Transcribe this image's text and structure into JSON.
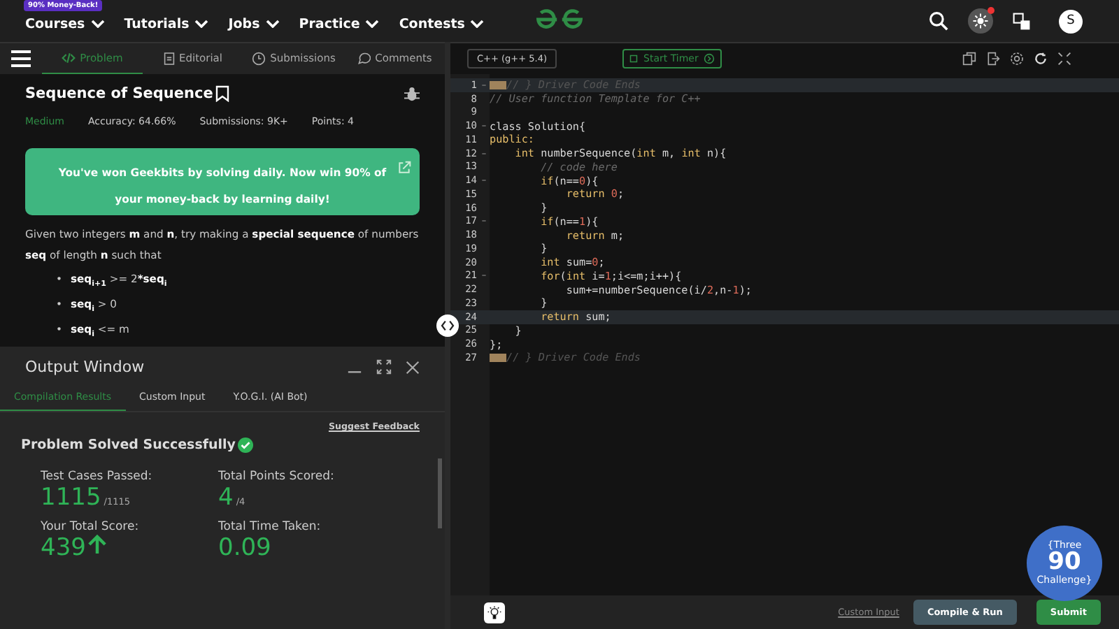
{
  "navbar": {
    "badge": "90% Money-Back!",
    "menus": [
      "Courses",
      "Tutorials",
      "Jobs",
      "Practice",
      "Contests"
    ],
    "avatar": "S",
    "notification": true
  },
  "problem_tabs": [
    {
      "label": "Problem",
      "selected": true
    },
    {
      "label": "Editorial",
      "selected": false
    },
    {
      "label": "Submissions",
      "selected": false
    },
    {
      "label": "Comments",
      "selected": false
    }
  ],
  "problem": {
    "title": "Sequence of Sequence",
    "difficulty": "Medium",
    "accuracy": "Accuracy: 64.66%",
    "submissions": "Submissions: 9K+",
    "points": "Points: 4",
    "banner": "You've won Geekbits by solving daily. Now win 90% of your money-back by learning daily!",
    "statement": "Given two integers **m** and **n**, try making a **special sequence** of numbers **seq** of length **n** such that",
    "conditions": [
      {
        "bullet": "•",
        "text": "**seq$_{i+1}$** >= 2***seq$_{i}$**"
      },
      {
        "bullet": "•",
        "text": "**seq$_{i}$** > 0"
      },
      {
        "bullet": "•",
        "text": "**seq$_{i}$** <= m"
      }
    ]
  },
  "output_window": {
    "title": "Output Window",
    "tabs": [
      {
        "label": "Compilation Results",
        "selected": true
      },
      {
        "label": "Custom Input",
        "selected": false
      },
      {
        "label": "Y.O.G.I. (AI Bot)",
        "selected": false
      }
    ],
    "feedback_link": "Suggest Feedback",
    "status": "Problem Solved Successfully",
    "stats": [
      {
        "label": "Test Cases Passed:",
        "value": "1115",
        "total": "/1115",
        "trend": false
      },
      {
        "label": "Total Points Scored:",
        "value": "4",
        "total": "/4",
        "trend": false
      },
      {
        "label": "Your Total Score:",
        "value": "439",
        "trend": true
      },
      {
        "label": "Total Time Taken:",
        "value": "0.09",
        "trend": false
      }
    ]
  },
  "editor": {
    "language": "C++ (g++ 5.4)",
    "timer_button": "Start Timer",
    "lines": [
      {
        "number": "1",
        "fold": true,
        "marker": true,
        "active": true,
        "code": [
          {
            "text": "// } Driver Code Ends",
            "kind": "dim"
          }
        ]
      },
      {
        "number": "8",
        "fold": false,
        "marker": false,
        "active": false,
        "code": [
          {
            "text": "// User function Template for C++",
            "kind": "comment"
          }
        ]
      },
      {
        "number": "9",
        "fold": false,
        "marker": false,
        "active": false
      },
      {
        "number": "10",
        "fold": true,
        "marker": false,
        "active": false,
        "code": [
          {
            "text": "class Solution{",
            "kind": "plain"
          }
        ]
      },
      {
        "number": "11",
        "fold": false,
        "marker": false,
        "active": false,
        "code": [
          {
            "text": "public:",
            "kind": "kw"
          }
        ]
      },
      {
        "number": "12",
        "fold": true,
        "marker": false,
        "active": false,
        "code": [
          {
            "text": "    int",
            "kind": "kw"
          },
          {
            "text": " numberSequence(",
            "kind": "plain"
          },
          {
            "text": "int",
            "kind": "kw"
          },
          {
            "text": " m, ",
            "kind": "plain"
          },
          {
            "text": "int",
            "kind": "kw"
          },
          {
            "text": " n){",
            "kind": "plain"
          }
        ]
      },
      {
        "number": "13",
        "fold": false,
        "marker": false,
        "active": false,
        "code": [
          {
            "text": "        // code here",
            "kind": "comment"
          }
        ]
      },
      {
        "number": "14",
        "fold": true,
        "marker": false,
        "active": false,
        "code": [
          {
            "text": "        if",
            "kind": "kw"
          },
          {
            "text": "(n==",
            "kind": "plain"
          },
          {
            "text": "0",
            "kind": "num"
          },
          {
            "text": "){",
            "kind": "plain"
          }
        ]
      },
      {
        "number": "15",
        "fold": false,
        "marker": false,
        "active": false,
        "code": [
          {
            "text": "            return",
            "kind": "kw"
          },
          {
            "text": " 0",
            "kind": "num"
          },
          {
            "text": ";",
            "kind": "plain"
          }
        ]
      },
      {
        "number": "16",
        "fold": false,
        "marker": false,
        "active": false,
        "code": [
          {
            "text": "        }",
            "kind": "plain"
          }
        ]
      },
      {
        "number": "17",
        "fold": true,
        "marker": false,
        "active": false,
        "code": [
          {
            "text": "        if",
            "kind": "kw"
          },
          {
            "text": "(n==",
            "kind": "plain"
          },
          {
            "text": "1",
            "kind": "num"
          },
          {
            "text": "){",
            "kind": "plain"
          }
        ]
      },
      {
        "number": "18",
        "fold": false,
        "marker": false,
        "active": false,
        "code": [
          {
            "text": "            return",
            "kind": "kw"
          },
          {
            "text": " m;",
            "kind": "plain"
          }
        ]
      },
      {
        "number": "19",
        "fold": false,
        "marker": false,
        "active": false,
        "code": [
          {
            "text": "        }",
            "kind": "plain"
          }
        ]
      },
      {
        "number": "20",
        "fold": false,
        "marker": false,
        "active": false,
        "code": [
          {
            "text": "        int",
            "kind": "kw"
          },
          {
            "text": " sum=",
            "kind": "plain"
          },
          {
            "text": "0",
            "kind": "num"
          },
          {
            "text": ";",
            "kind": "plain"
          }
        ]
      },
      {
        "number": "21",
        "fold": true,
        "marker": false,
        "active": false,
        "code": [
          {
            "text": "        for",
            "kind": "kw"
          },
          {
            "text": "(",
            "kind": "plain"
          },
          {
            "text": "int",
            "kind": "kw"
          },
          {
            "text": " i=",
            "kind": "plain"
          },
          {
            "text": "1",
            "kind": "num"
          },
          {
            "text": ";i<=m;i++){",
            "kind": "plain"
          }
        ]
      },
      {
        "number": "22",
        "fold": false,
        "marker": false,
        "active": false,
        "code": [
          {
            "text": "            sum+=numberSequence(i/",
            "kind": "plain"
          },
          {
            "text": "2",
            "kind": "num"
          },
          {
            "text": ",n-",
            "kind": "plain"
          },
          {
            "text": "1",
            "kind": "num"
          },
          {
            "text": ");",
            "kind": "plain"
          }
        ]
      },
      {
        "number": "23",
        "fold": false,
        "marker": false,
        "active": false,
        "code": [
          {
            "text": "        }",
            "kind": "plain"
          }
        ]
      },
      {
        "number": "24",
        "fold": false,
        "marker": false,
        "active": true,
        "code": [
          {
            "text": "        return",
            "kind": "kw"
          },
          {
            "text": " sum;",
            "kind": "plain"
          }
        ]
      },
      {
        "number": "25",
        "fold": false,
        "marker": false,
        "active": false,
        "code": [
          {
            "text": "    }",
            "kind": "plain"
          }
        ]
      },
      {
        "number": "26",
        "fold": false,
        "marker": false,
        "active": false,
        "code": [
          {
            "text": "};",
            "kind": "plain"
          }
        ]
      },
      {
        "number": "27",
        "fold": false,
        "marker": true,
        "active": false,
        "code": [
          {
            "text": "// } Driver Code Ends",
            "kind": "dim"
          }
        ]
      }
    ],
    "custom_input_link": "Custom Input",
    "compile_button": "Compile & Run",
    "submit_button": "Submit"
  },
  "challenge_badge": {
    "top": "{Three",
    "number": "90",
    "bottom": "Challenge}"
  }
}
